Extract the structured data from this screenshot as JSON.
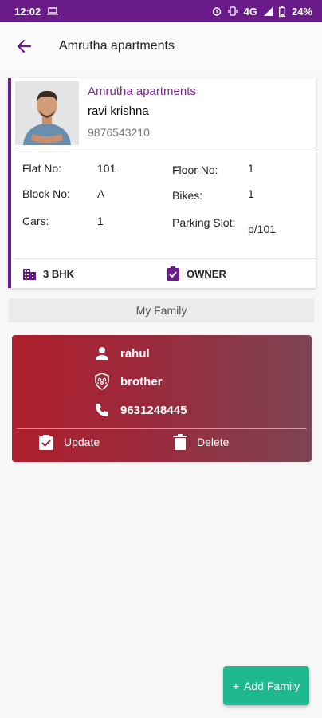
{
  "status_bar": {
    "time": "12:02",
    "network": "4G",
    "battery": "24%"
  },
  "app_bar": {
    "title": "Amrutha apartments"
  },
  "resident": {
    "apartment": "Amrutha apartments",
    "name": "ravi krishna",
    "phone": "9876543210",
    "fields": {
      "flat_label": "Flat No:",
      "flat_value": "101",
      "floor_label": "Floor No:",
      "floor_value": "1",
      "block_label": "Block No:",
      "block_value": "A",
      "bikes_label": "Bikes:",
      "bikes_value": "1",
      "cars_label": "Cars:",
      "cars_value": "1",
      "parking_label": "Parking Slot:",
      "parking_value": "p/101"
    },
    "type": "3 BHK",
    "role": "OWNER"
  },
  "family_section": {
    "title": "My Family"
  },
  "family_member": {
    "name": "rahul",
    "relation": "brother",
    "phone": "9631248445",
    "update_label": "Update",
    "delete_label": "Delete"
  },
  "fab": {
    "label": "Add Family",
    "icon": "+"
  },
  "colors": {
    "primary": "#6a1b8a",
    "accent": "#1fb98f",
    "card_red": "#b01f2d"
  }
}
